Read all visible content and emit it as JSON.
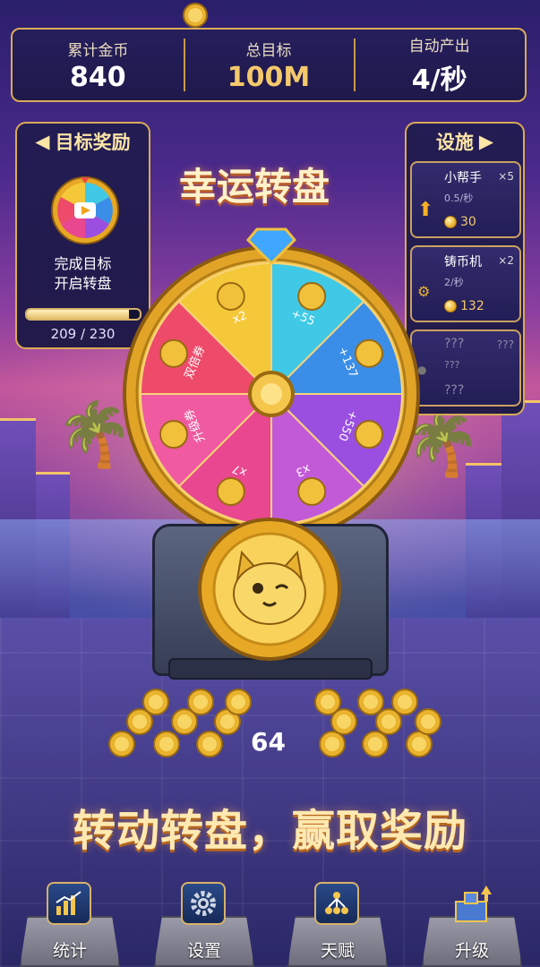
{
  "stats": [
    {
      "label": "累计金币",
      "value": "840"
    },
    {
      "label": "总目标",
      "value": "100M"
    },
    {
      "label": "自动产出",
      "value": "4/秒"
    }
  ],
  "goal_panel": {
    "title": "目标奖励",
    "desc_line1": "完成目标",
    "desc_line2": "开启转盘",
    "progress_text": "209 / 230",
    "progress_current": 209,
    "progress_total": 230
  },
  "facilities": {
    "title": "设施",
    "items": [
      {
        "name": "小帮手",
        "count": "×5",
        "rate": "0.5/秒",
        "cost": "30",
        "icon": "arrow-up-icon"
      },
      {
        "name": "铸币机",
        "count": "×2",
        "rate": "2/秒",
        "cost": "132",
        "icon": "coin-machine-icon"
      },
      {
        "name": "???",
        "count": "???",
        "rate": "???",
        "cost": "???",
        "icon": "locked-icon"
      }
    ]
  },
  "title": "幸运转盘",
  "wheel": {
    "segments": [
      {
        "label": "x2",
        "color": "#f5c83a"
      },
      {
        "label": "+55",
        "color": "#3fc9e6"
      },
      {
        "label": "+137",
        "color": "#3a8ee8"
      },
      {
        "label": "+550",
        "color": "#9a4fe0"
      },
      {
        "label": "x3",
        "color": "#c25ad8"
      },
      {
        "label": "x7",
        "color": "#e9478f"
      },
      {
        "label": "升级券",
        "color": "#f05aa0"
      },
      {
        "label": "双倍券",
        "color": "#ee4a6a"
      }
    ]
  },
  "coin_count": "64",
  "slogan": "转动转盘，赢取奖励",
  "nav": [
    {
      "label": "统计",
      "icon": "stats-chart-icon"
    },
    {
      "label": "设置",
      "icon": "gear-icon"
    },
    {
      "label": "天赋",
      "icon": "talent-tree-icon"
    },
    {
      "label": "升级",
      "icon": "upgrade-castle-icon"
    }
  ],
  "colors": {
    "gold": "#d9aa57",
    "panel": "#201c50",
    "accent": "#fde5a6"
  }
}
